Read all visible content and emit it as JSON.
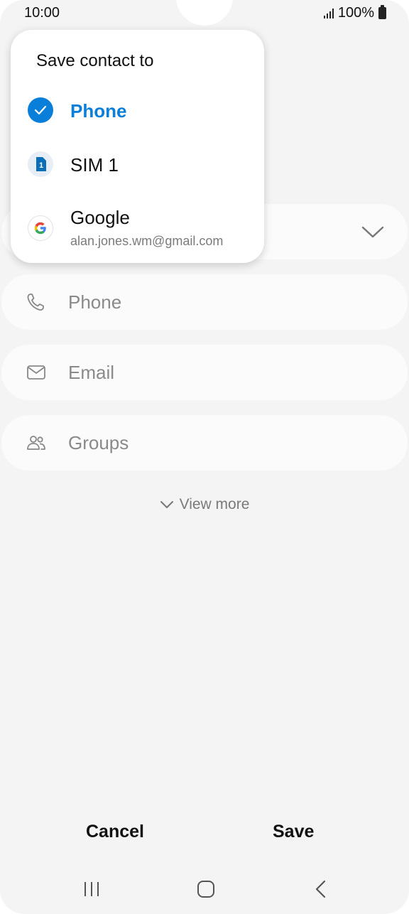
{
  "status": {
    "time": "10:00",
    "battery": "100%"
  },
  "form": {
    "fields": [
      {
        "name": "account",
        "label": ""
      },
      {
        "name": "phone",
        "label": "Phone"
      },
      {
        "name": "email",
        "label": "Email"
      },
      {
        "name": "groups",
        "label": "Groups"
      }
    ],
    "view_more": "View more"
  },
  "popup": {
    "title": "Save contact to",
    "options": [
      {
        "label": "Phone",
        "selected": true
      },
      {
        "label": "SIM 1",
        "badge": "1"
      },
      {
        "label": "Google",
        "sub": "alan.jones.wm@gmail.com",
        "logo": "G"
      }
    ]
  },
  "actions": {
    "cancel": "Cancel",
    "save": "Save"
  },
  "colors": {
    "accent": "#0a7fd9",
    "background": "#f4f4f4",
    "field": "#fbfbfb"
  },
  "icons": [
    "signal-icon",
    "battery-icon",
    "phone-icon",
    "email-icon",
    "groups-icon",
    "chevron-down-icon",
    "check-icon",
    "sim-card-icon",
    "google-logo-icon",
    "recents-nav-icon",
    "home-nav-icon",
    "back-nav-icon"
  ]
}
